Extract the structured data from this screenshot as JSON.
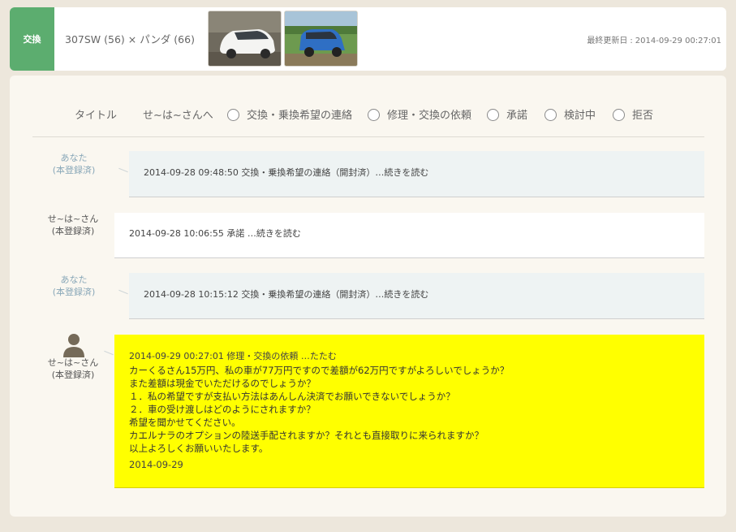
{
  "header": {
    "badge": "交換",
    "title": "307SW (56) × パンダ (66)",
    "updated_label": "最終更新日",
    "updated_sep": ":",
    "updated_value": "2014-09-29 00:27:01"
  },
  "filter": {
    "title_label": "タイトル",
    "name_label": "せ~は~さんへ",
    "options": [
      "交換・乗換希望の連絡",
      "修理・交換の依頼",
      "承諾",
      "検討中",
      "拒否"
    ]
  },
  "messages": [
    {
      "sender": "あなた",
      "status": "(本登録済)",
      "text": "2014-09-28 09:48:50 交換・乗換希望の連絡（開封済）…続きを読む"
    },
    {
      "sender": "せ~は~さん",
      "status": "(本登録済)",
      "text": "2014-09-28 10:06:55 承諾 …続きを読む"
    },
    {
      "sender": "あなた",
      "status": "(本登録済)",
      "text": "2014-09-28 10:15:12 交換・乗換希望の連絡（開封済）…続きを読む"
    },
    {
      "sender": "せ~は~さん",
      "status": "(本登録済)",
      "head": "2014-09-29 00:27:01 修理・交換の依頼 …たたむ",
      "body": [
        "カーくるさん15万円、私の車が77万円ですので差額が62万円ですがよろしいでしょうか？",
        "また差額は現金でいただけるのでしょうか？",
        "１．私の希望ですが支払い方法はあんしん決済でお願いできないでしょうか？",
        "２．車の受け渡しはどのようにされますか？",
        "希望を聞かせてください。",
        "カエルナラのオプションの陸送手配されますか？それとも直接取りに来られますか？",
        "以上よろしくお願いいたします。"
      ],
      "date": "2014-09-29"
    }
  ],
  "colors": {
    "badge": "#5cad6f",
    "highlight": "#ffff00",
    "mine_bg": "#eef3f3",
    "you_label": "#88a7b8"
  }
}
